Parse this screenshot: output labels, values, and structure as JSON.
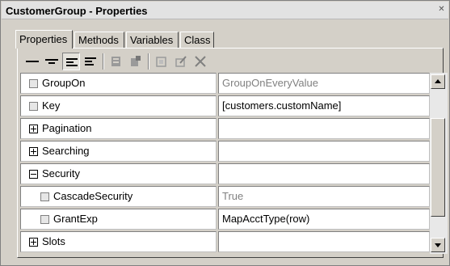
{
  "window": {
    "title": "CustomerGroup - Properties",
    "close_glyph": "✕"
  },
  "tabs": [
    {
      "label": "Properties",
      "active": true
    },
    {
      "label": "Methods",
      "active": false
    },
    {
      "label": "Variables",
      "active": false
    },
    {
      "label": "Class",
      "active": false
    }
  ],
  "toolbar": {
    "buttons": [
      {
        "icon": "show-all-properties-icon"
      },
      {
        "icon": "show-set-properties-icon"
      },
      {
        "icon": "align-left-icon",
        "pressed": true
      },
      {
        "icon": "align-indent-icon"
      },
      {
        "icon": "database-props-icon"
      },
      {
        "icon": "inherit-props-icon"
      },
      {
        "icon": "new-property-icon"
      },
      {
        "icon": "edit-property-icon"
      },
      {
        "icon": "delete-icon"
      }
    ]
  },
  "properties": [
    {
      "name": "GroupOn",
      "value": "GroupOnEveryValue",
      "type": "checkbox",
      "muted": true
    },
    {
      "name": "Key",
      "value": "[customers.customName]",
      "type": "checkbox",
      "muted": false
    },
    {
      "name": "Pagination",
      "value": "",
      "type": "expand",
      "muted": false
    },
    {
      "name": "Searching",
      "value": "",
      "type": "expand",
      "muted": false
    },
    {
      "name": "Security",
      "value": "",
      "type": "collapse",
      "muted": false
    },
    {
      "name": "CascadeSecurity",
      "value": "True",
      "type": "checkbox-child",
      "muted": true
    },
    {
      "name": "GrantExp",
      "value": "MapAcctType(row)",
      "type": "checkbox-child",
      "muted": false
    },
    {
      "name": "Slots",
      "value": "",
      "type": "expand",
      "muted": false
    }
  ],
  "colors": {
    "window_bg": "#d4d0c8",
    "cell_bg": "#ffffff",
    "muted_text": "#808080"
  }
}
